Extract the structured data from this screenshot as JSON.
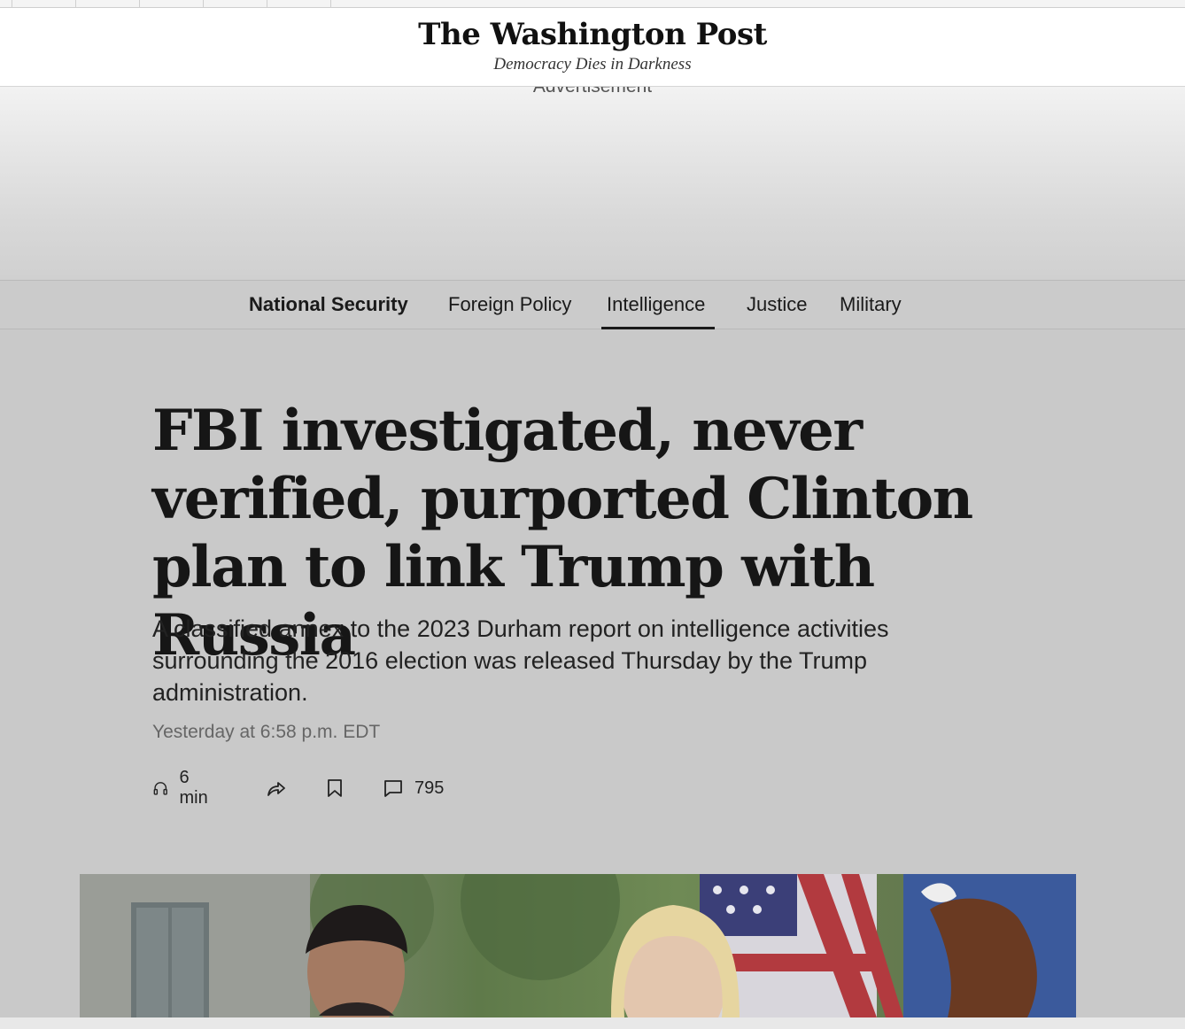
{
  "masthead": {
    "logo": "The Washington Post",
    "tagline": "Democracy Dies in Darkness"
  },
  "ad": {
    "label": "Advertisement"
  },
  "subnav": {
    "items": [
      {
        "label": "National Security"
      },
      {
        "label": "Foreign Policy"
      },
      {
        "label": "Intelligence"
      },
      {
        "label": "Justice"
      },
      {
        "label": "Military"
      }
    ],
    "active": "Intelligence"
  },
  "article": {
    "headline": "FBI investigated, never verified, purported Clinton plan to link Trump with Russia",
    "dek": "A classified annex to the 2023 Durham report on intelligence activities surrounding the 2016 election was released Thursday by the Trump administration.",
    "timestamp": "Yesterday at 6:58 p.m. EDT",
    "listen_duration": "6 min",
    "comment_count": "795"
  },
  "icons": {
    "listen": "headphones-icon",
    "share": "share-icon",
    "save": "bookmark-icon",
    "comments": "comment-icon"
  }
}
